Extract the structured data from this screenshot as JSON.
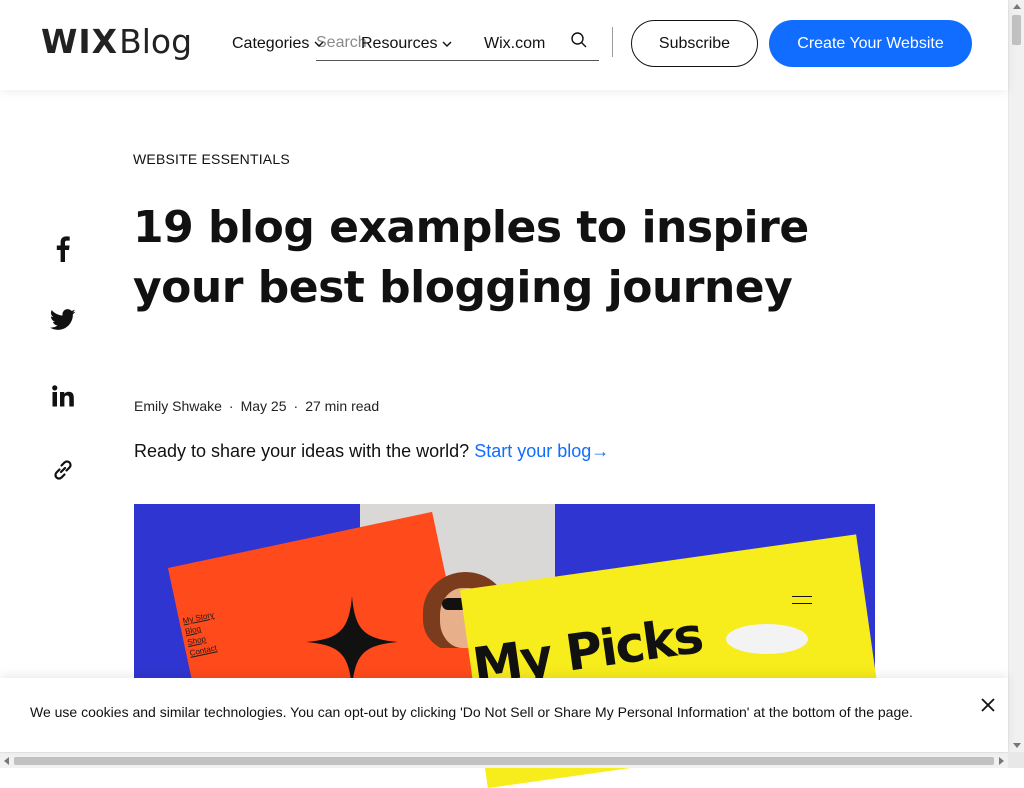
{
  "brand": {
    "logo_bold": "WIX",
    "logo_light": "Blog"
  },
  "nav": {
    "categories": "Categories",
    "resources": "Resources",
    "wix": "Wix.com"
  },
  "search": {
    "placeholder": "Search"
  },
  "header_buttons": {
    "subscribe": "Subscribe",
    "create": "Create Your Website"
  },
  "colors": {
    "accent": "#116dff",
    "hero_bg": "#2f35d0",
    "hero_orange": "#ff4b1c",
    "hero_yellow": "#f7ec1c"
  },
  "article": {
    "category": "WEBSITE ESSENTIALS",
    "title": "19 blog examples to inspire your best blogging journey",
    "author": "Emily Shwake",
    "date": "May 25",
    "read_time": "27 min read",
    "cta_text": "Ready to share your ideas with the world?",
    "cta_link": "Start your blog",
    "cta_arrow": "→"
  },
  "hero": {
    "menu": [
      "My Story",
      "Blog",
      "Shop",
      "Contact"
    ],
    "headline": "My Picks"
  },
  "social": [
    "facebook-icon",
    "twitter-icon",
    "linkedin-icon",
    "link-icon"
  ],
  "cookie": {
    "text": "We use cookies and similar technologies. You can opt-out by clicking 'Do Not Sell or Share My Personal Information' at the bottom of the page."
  }
}
